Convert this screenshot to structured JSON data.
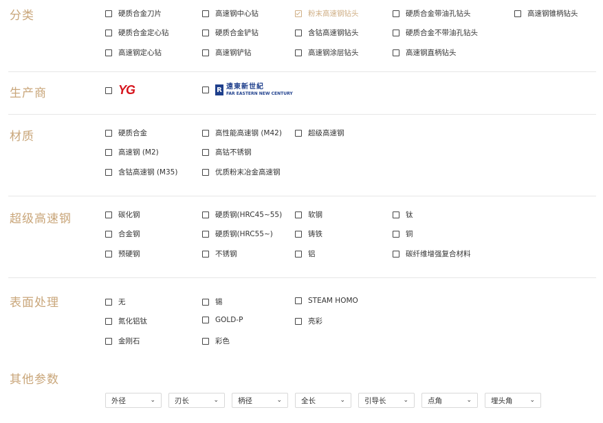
{
  "sections": {
    "category": {
      "title": "分类",
      "options": [
        "硬质合金刀片",
        "高速钢中心钻",
        "粉末高速钢钻头",
        "硬质合金带油孔钻头",
        "高速钢锥柄钻头",
        "硬质合金定心钻",
        "硬质合金铲钻",
        "含钴高速钢钻头",
        "硬质合金不带油孔钻头",
        "高速钢定心钻",
        "高速钢铲钻",
        "高速钢涂层钻头",
        "高速钢直柄钻头"
      ],
      "checked": "粉末高速钢钻头"
    },
    "manufacturer": {
      "title": "生产商",
      "logo1_text": "YG",
      "logo2_cn": "遠東新世紀",
      "logo2_en": "FAR EASTERN NEW CENTURY",
      "logo2_mark": "R"
    },
    "material": {
      "title": "材质",
      "options": [
        "硬质合金",
        "高性能高速钢 (M42)",
        "超级高速钢",
        "高速钢 (M2)",
        "高钴不锈钢",
        "含钴高速钢 (M35)",
        "优质粉末冶金高速钢"
      ]
    },
    "workpiece": {
      "title": "超级高速钢",
      "options": [
        "碳化钢",
        "硬质钢(HRC45~55)",
        "软钢",
        "钛",
        "合金钢",
        "硬质钢(HRC55~)",
        "铸铁",
        "铜",
        "预硬钢",
        "不锈钢",
        "铝",
        "碳纤维增强复合材料"
      ]
    },
    "surface": {
      "title": "表面处理",
      "options": [
        "无",
        "锡",
        "STEAM HOMO",
        "氮化铝钛",
        "GOLD-P",
        "亮彩",
        "金刚石",
        "彩色"
      ]
    },
    "params": {
      "title": "其他参数",
      "selects": [
        "外径",
        "刃长",
        "柄径",
        "全长",
        "引导长",
        "点角",
        "埋头角"
      ]
    }
  },
  "colors": {
    "accent": "#c9a67a",
    "divider": "#e6e6e6"
  },
  "icons": {
    "checkbox": "checkbox-icon",
    "dropdown": "chevron-down-icon"
  }
}
